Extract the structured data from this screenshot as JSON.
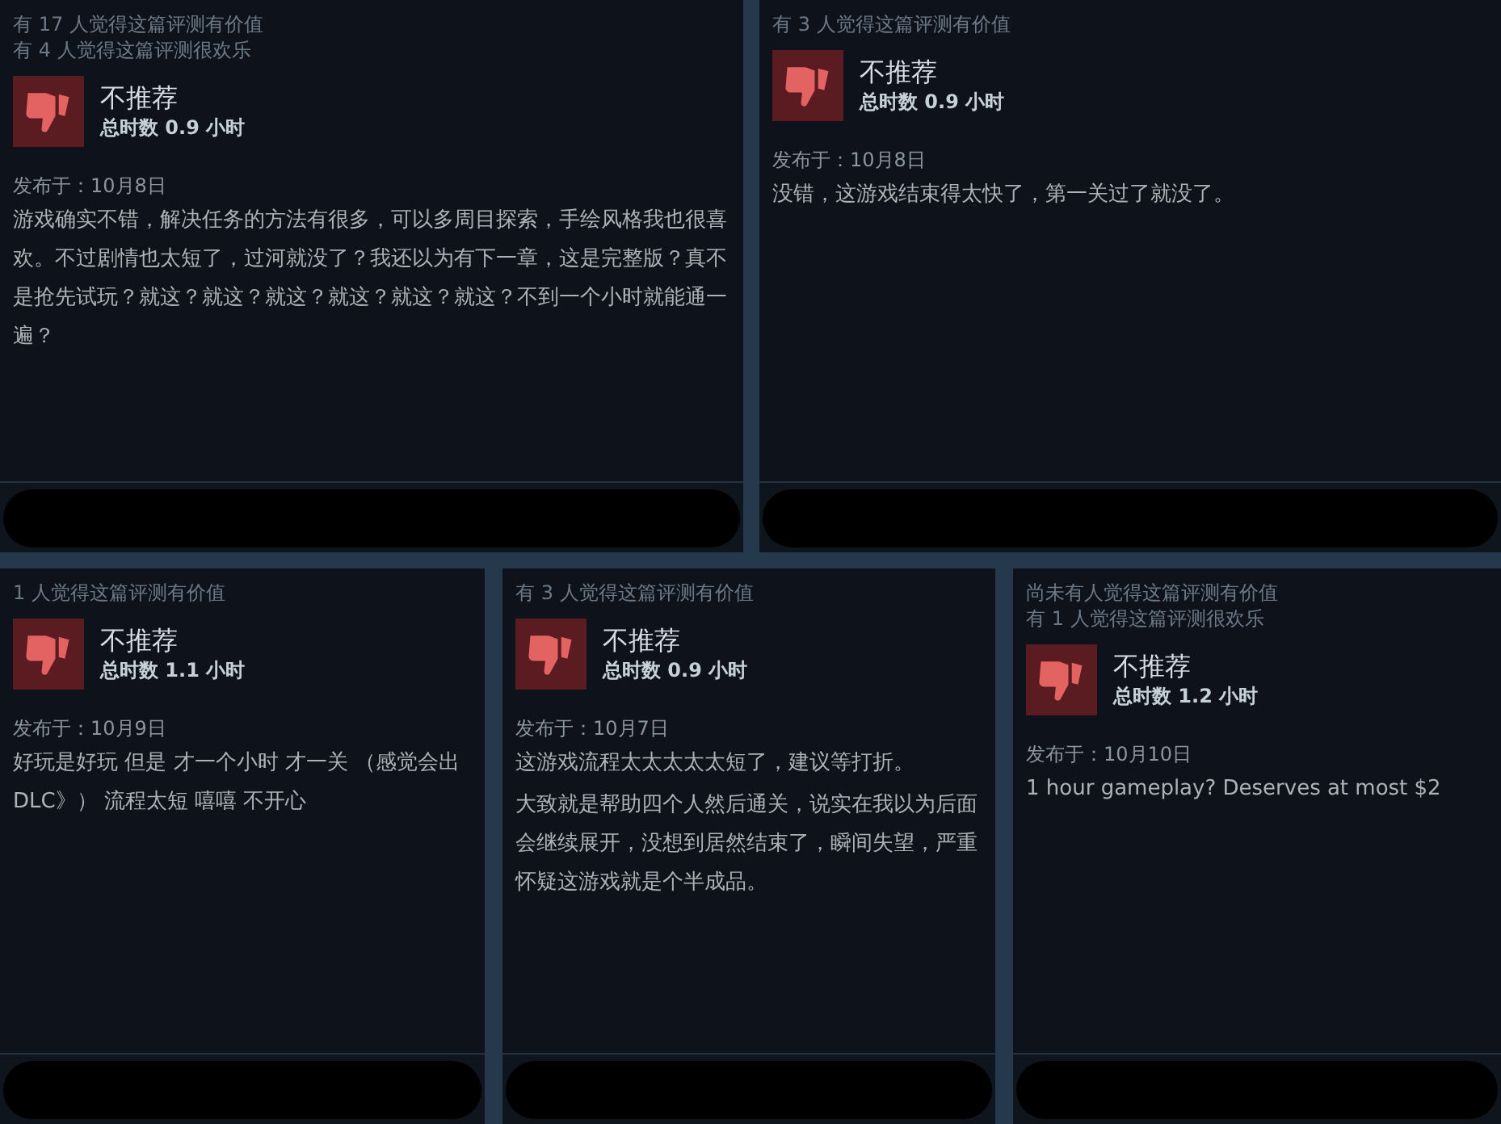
{
  "reviews": [
    {
      "helpful": [
        "有 17 人觉得这篇评测有价值",
        "有 4 人觉得这篇评测很欢乐"
      ],
      "verdict": "不推荐",
      "hours": "总时数 0.9 小时",
      "posted": "发布于：10月8日",
      "body": [
        "游戏确实不错，解决任务的方法有很多，可以多周目探索，手绘风格我也很喜欢。不过剧情也太短了，过河就没了？我还以为有下一章，这是完整版？真不是抢先试玩？就这？就这？就这？就这？就这？就这？不到一个小时就能通一遍？"
      ]
    },
    {
      "helpful": [
        "有 3 人觉得这篇评测有价值"
      ],
      "verdict": "不推荐",
      "hours": "总时数 0.9 小时",
      "posted": "发布于：10月8日",
      "body": [
        "没错，这游戏结束得太快了，第一关过了就没了。"
      ]
    },
    {
      "helpful": [
        "1 人觉得这篇评测有价值"
      ],
      "verdict": "不推荐",
      "hours": "总时数 1.1 小时",
      "posted": "发布于：10月9日",
      "body": [
        "好玩是好玩 但是 才一个小时 才一关 （感觉会出DLC》） 流程太短 嘻嘻 不开心"
      ]
    },
    {
      "helpful": [
        "有 3 人觉得这篇评测有价值"
      ],
      "verdict": "不推荐",
      "hours": "总时数 0.9 小时",
      "posted": "发布于：10月7日",
      "body": [
        "这游戏流程太太太太太短了，建议等打折。",
        "大致就是帮助四个人然后通关，说实在我以为后面会继续展开，没想到居然结束了，瞬间失望，严重怀疑这游戏就是个半成品。"
      ]
    },
    {
      "helpful": [
        "尚未有人觉得这篇评测有价值",
        "有 1 人觉得这篇评测很欢乐"
      ],
      "verdict": "不推荐",
      "hours": "总时数 1.2 小时",
      "posted": "发布于：10月10日",
      "body": [
        "1 hour gameplay? Deserves at most $2"
      ]
    }
  ]
}
